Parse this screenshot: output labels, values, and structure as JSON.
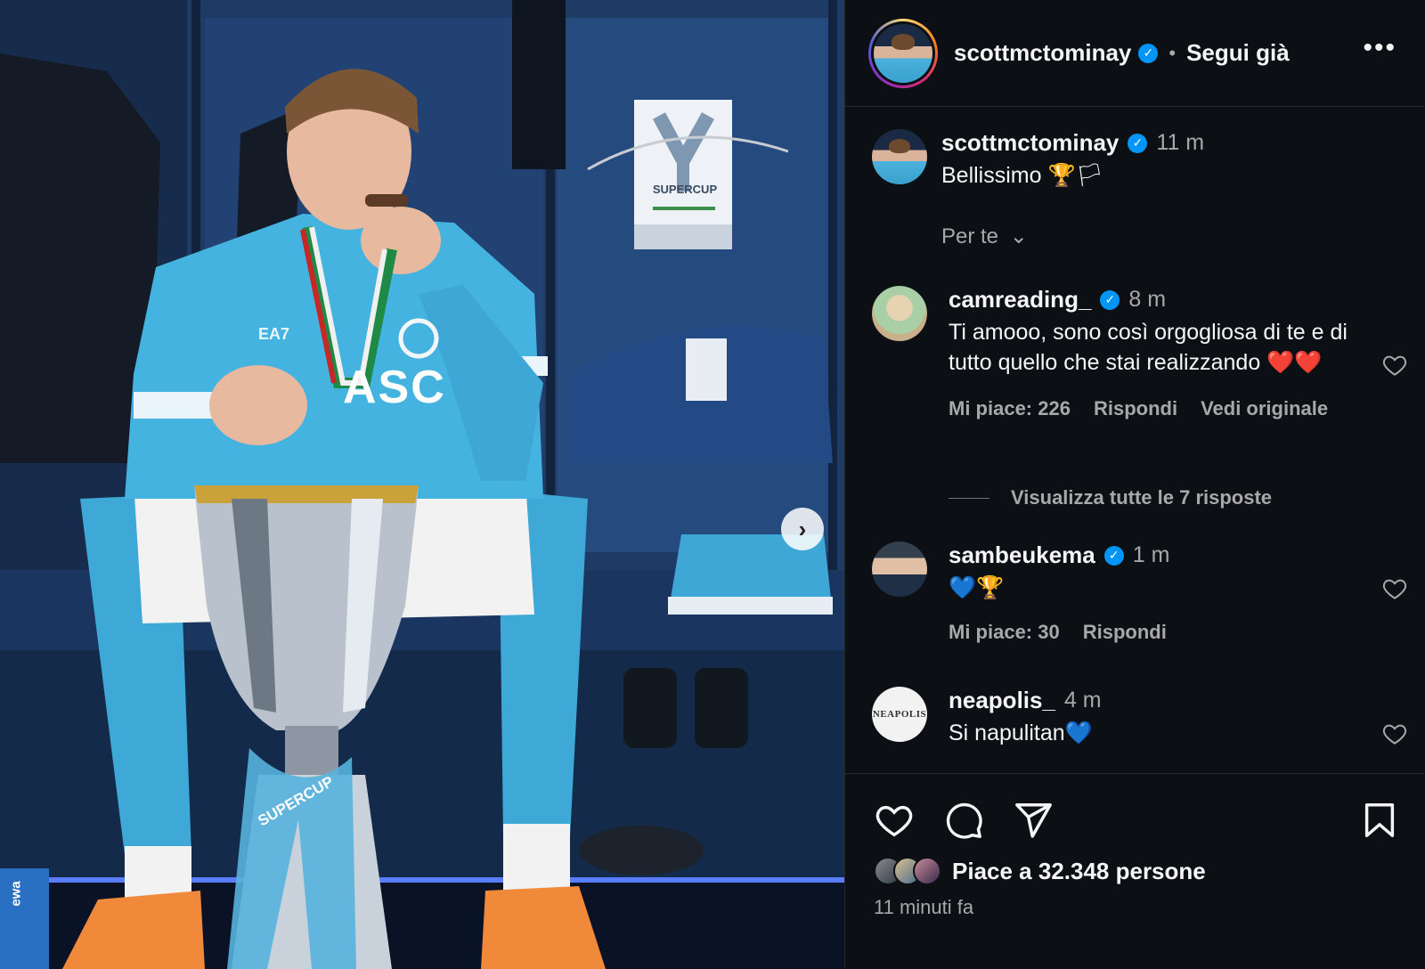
{
  "post": {
    "author": "scottmctominay",
    "follow_status": "Segui già",
    "more": "•••",
    "caption_author": "scottmctominay",
    "caption_time": "11 m",
    "caption_text": "Bellissimo 🏆🏳",
    "sort_label": "Per te",
    "likes_text": "Piace a 32.348 persone",
    "posted_ago": "11 minuti fa"
  },
  "photo": {
    "supercup_card": "SUPERCUP",
    "sponsor": "EA7",
    "shirt_text": "ASC",
    "trophy_ribbon": "SUPERCUP",
    "bottle_label": "ewa",
    "next_arrow": "›"
  },
  "comments": [
    {
      "user": "camreading_",
      "time": "8 m",
      "text": "Ti amooo, sono così orgogliosa di te e di tutto quello che stai realizzando ❤️❤️",
      "likes": "Mi piace: 226",
      "reply": "Rispondi",
      "translate": "Vedi originale",
      "view_replies": "Visualizza tutte le 7 risposte"
    },
    {
      "user": "sambeukema",
      "time": "1 m",
      "text": "💙🏆",
      "likes": "Mi piace: 30",
      "reply": "Rispondi"
    },
    {
      "user": "neapolis_",
      "time": "4 m",
      "text": "Si napulitan💙",
      "avatar_text": "NEAPOLIS"
    }
  ],
  "icons": {
    "verified": "✓",
    "chevron": "⌄"
  },
  "colors": {
    "panel_bg": "#0c1014",
    "verified_blue": "#0095f6",
    "muted": "#a8a8a8"
  }
}
